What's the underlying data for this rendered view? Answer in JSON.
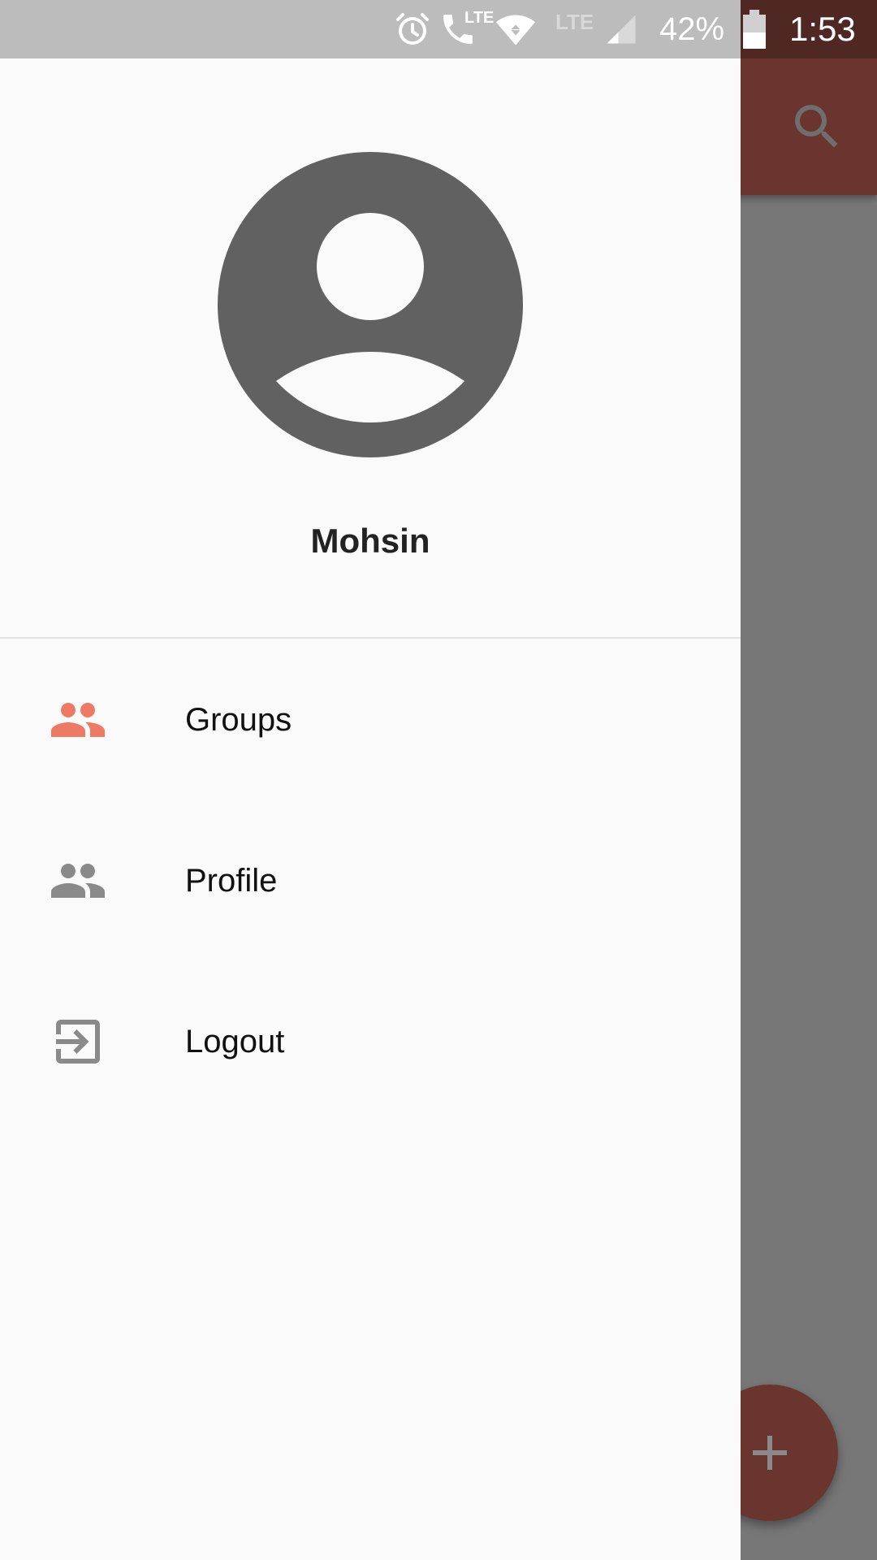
{
  "status_bar": {
    "battery_percent": "42%",
    "time": "1:53",
    "network_label": "LTE",
    "call_network_label": "LTE",
    "icons": [
      "alarm-icon",
      "volte-call-icon",
      "wifi-icon",
      "signal-icon",
      "battery-icon"
    ]
  },
  "app_bar": {
    "search_icon": "search-icon",
    "color": "#6b352f"
  },
  "drawer": {
    "user": {
      "name": "Mohsin",
      "avatar_icon": "account-circle-icon"
    },
    "items": [
      {
        "label": "Groups",
        "icon": "group-icon",
        "active": true,
        "color": "#ef7a63"
      },
      {
        "label": "Profile",
        "icon": "group-icon",
        "active": false,
        "color": "#8a8a8a"
      },
      {
        "label": "Logout",
        "icon": "logout-icon",
        "active": false,
        "color": "#8a8a8a"
      }
    ]
  },
  "fab": {
    "icon": "plus-icon"
  },
  "colors": {
    "accent": "#ef7a63",
    "primary_dark": "#502823",
    "primary": "#6b352f",
    "drawer_bg": "#fafafa"
  }
}
